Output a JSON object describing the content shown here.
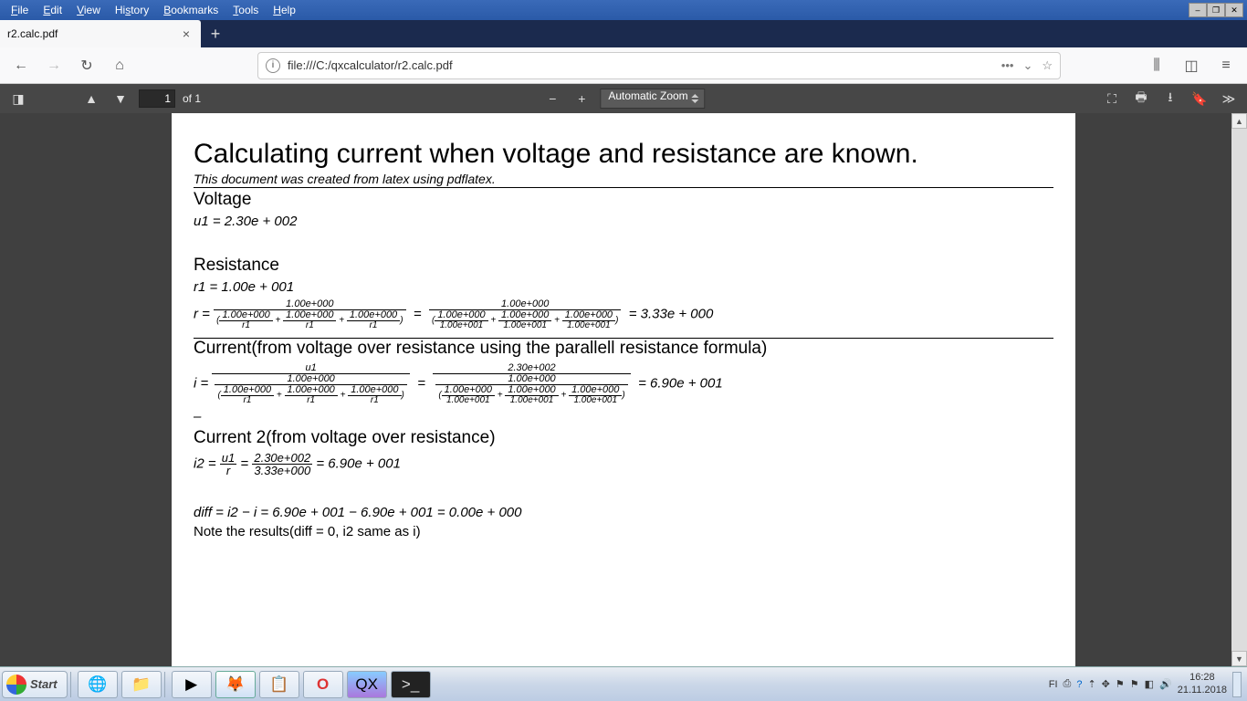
{
  "menu": {
    "file": "File",
    "edit": "Edit",
    "view": "View",
    "history": "History",
    "bookmarks": "Bookmarks",
    "tools": "Tools",
    "help": "Help"
  },
  "tab": {
    "title": "r2.calc.pdf"
  },
  "url": {
    "value": "file:///C:/qxcalculator/r2.calc.pdf"
  },
  "pdfbar": {
    "page": "1",
    "pages_suffix": "of 1",
    "zoom": "Automatic Zoom"
  },
  "doc": {
    "title": "Calculating current when voltage and resistance are known.",
    "subtitle": "This document was created from latex using pdflatex.",
    "voltage_h": "Voltage",
    "voltage_eq": "u1 = 2.30e + 002",
    "resistance_h": "Resistance",
    "r1_eq": "r1 = 1.00e + 001",
    "r_result": "= 3.33e + 000",
    "current_h": "Current(from voltage over resistance using the parallell resistance formula)",
    "i_result": "= 6.90e + 001",
    "dash": "–",
    "current2_h": "Current 2(from voltage over resistance)",
    "i2_mid": "= 6.90e + 001",
    "diff_eq": "diff = i2 − i = 6.90e + 001 − 6.90e + 001 = 0.00e + 000",
    "note": "Note the results(diff = 0, i2 same as i)",
    "num_100": "1.00e+000",
    "num_101": "1.00e+001",
    "r1": "r1",
    "u1": "u1",
    "num_230": "2.30e+002",
    "num_333": "3.33e+000"
  },
  "taskbar": {
    "start": "Start",
    "lang": "FI",
    "time": "16:28",
    "date": "21.11.2018"
  }
}
